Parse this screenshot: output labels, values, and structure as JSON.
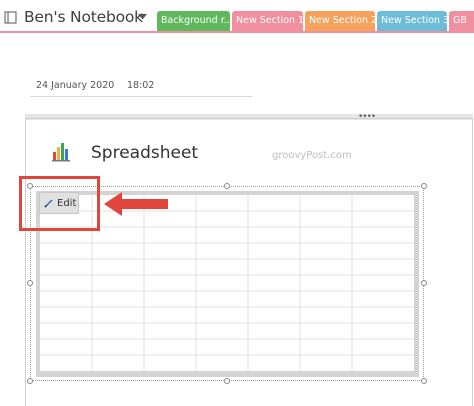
{
  "notebook": {
    "title": "Ben's Notebook",
    "icon": "notebook-icon"
  },
  "tabs": [
    {
      "label": "Background r...",
      "color": "#5fb85b"
    },
    {
      "label": "New Section 1",
      "color": "#f08f9f"
    },
    {
      "label": "New Section 2",
      "color": "#f5a25d"
    },
    {
      "label": "New Section 3",
      "color": "#6dbcd8"
    },
    {
      "label": "GB",
      "color": "#f08f9f"
    }
  ],
  "page": {
    "date": "24 January 2020",
    "time": "18:02"
  },
  "spreadsheet": {
    "title": "Spreadsheet",
    "icon": "chart-icon",
    "edit_label": "Edit",
    "watermark": "groovyPost.com"
  },
  "colors": {
    "accent_red": "#e1453b",
    "tab_pink": "#f08f9f"
  }
}
